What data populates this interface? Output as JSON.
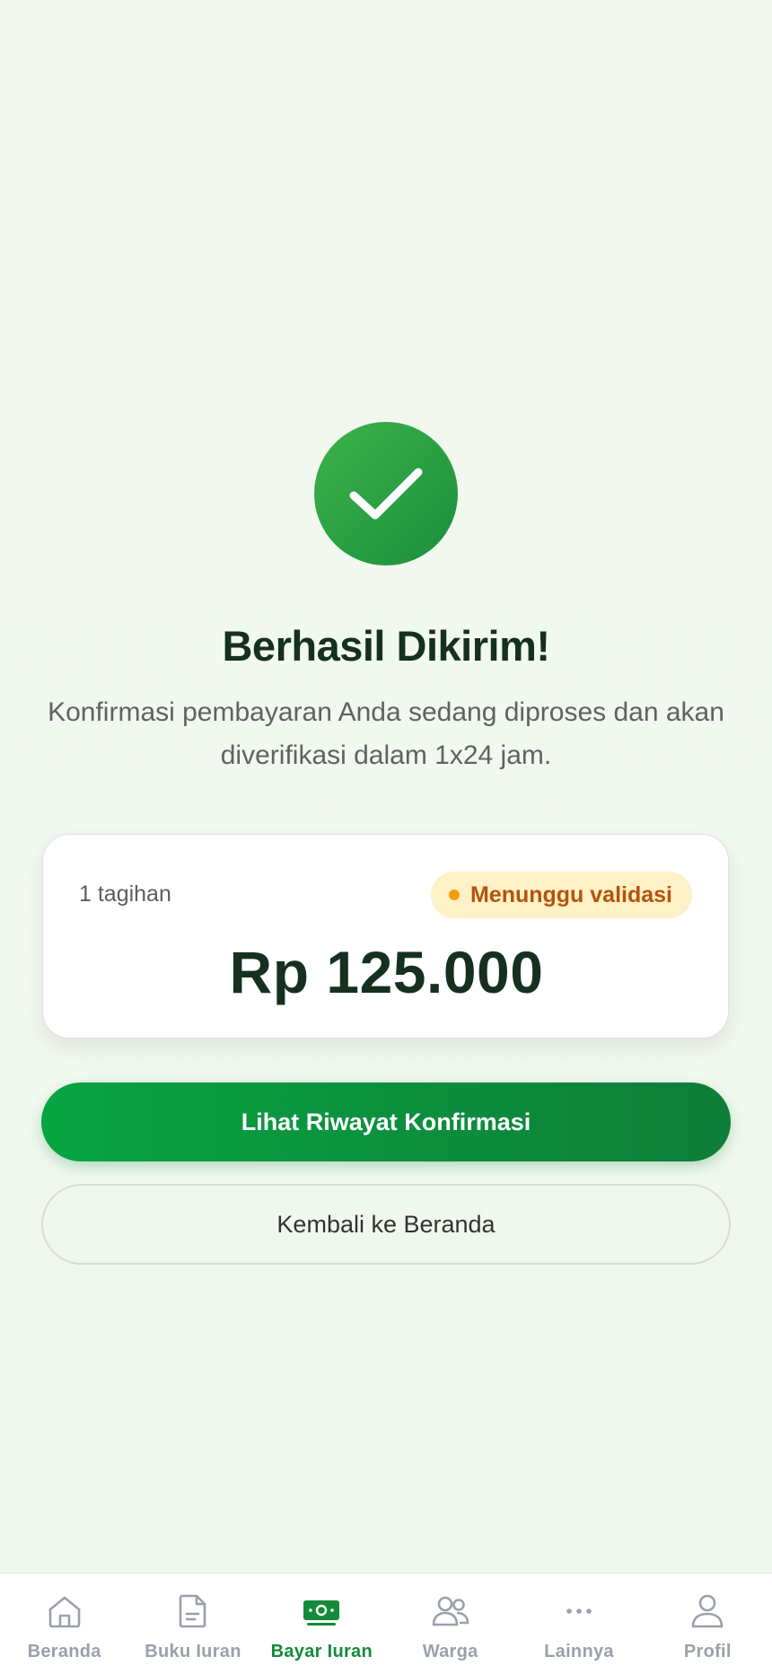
{
  "success": {
    "icon": "check-icon",
    "title": "Berhasil Dikirim!",
    "message": "Konfirmasi pembayaran Anda sedang diproses dan akan diverifikasi dalam 1x24 jam."
  },
  "summary": {
    "bill_count": "1 tagihan",
    "status": "Menunggu validasi",
    "amount": "Rp 125.000"
  },
  "actions": {
    "primary_label": "Lihat Riwayat Konfirmasi",
    "secondary_label": "Kembali ke Beranda"
  },
  "nav": {
    "items": [
      {
        "label": "Beranda",
        "icon": "home-icon"
      },
      {
        "label": "Buku Iuran",
        "icon": "document-icon"
      },
      {
        "label": "Bayar Iuran",
        "icon": "money-icon",
        "active": true
      },
      {
        "label": "Warga",
        "icon": "users-icon"
      },
      {
        "label": "Lainnya",
        "icon": "more-icon"
      },
      {
        "label": "Profil",
        "icon": "user-icon"
      }
    ]
  },
  "colors": {
    "primary": "#0f8a3c",
    "status_bg": "#fdf1c7",
    "status_text": "#b4540b",
    "background": "#f1f8ef"
  }
}
